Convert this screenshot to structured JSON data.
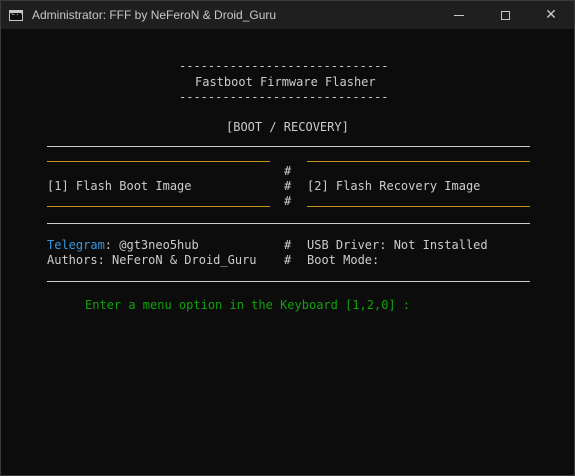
{
  "window": {
    "title": "Administrator:  FFF by NeFeroN & Droid_Guru",
    "icon": "console-icon",
    "icon_glyph": "C:\\",
    "controls": {
      "minimize": "minimize-icon",
      "maximize": "maximize-icon",
      "close": "close-icon",
      "close_glyph": "✕"
    }
  },
  "console": {
    "dash_line": "-----------------------------",
    "header_title": "Fastboot Firmware Flasher",
    "section_title": "[BOOT / RECOVERY]",
    "separator": "#",
    "menu": {
      "option1": "[1] Flash Boot Image",
      "option2": "[2] Flash Recovery Image"
    },
    "info": {
      "telegram_label": "Telegram",
      "telegram_value": ": @gt3neo5hub",
      "authors": "Authors: NeFeroN & Droid_Guru",
      "usb_driver": "USB Driver: Not Installed",
      "boot_mode": "Boot Mode:"
    },
    "prompt": "Enter a menu option in the Keyboard [1,2,0] :"
  },
  "colors": {
    "background": "#0c0c0c",
    "text": "#cccccc",
    "accent_line": "#c8961e",
    "telegram": "#3a96dd",
    "prompt": "#13a10e"
  }
}
